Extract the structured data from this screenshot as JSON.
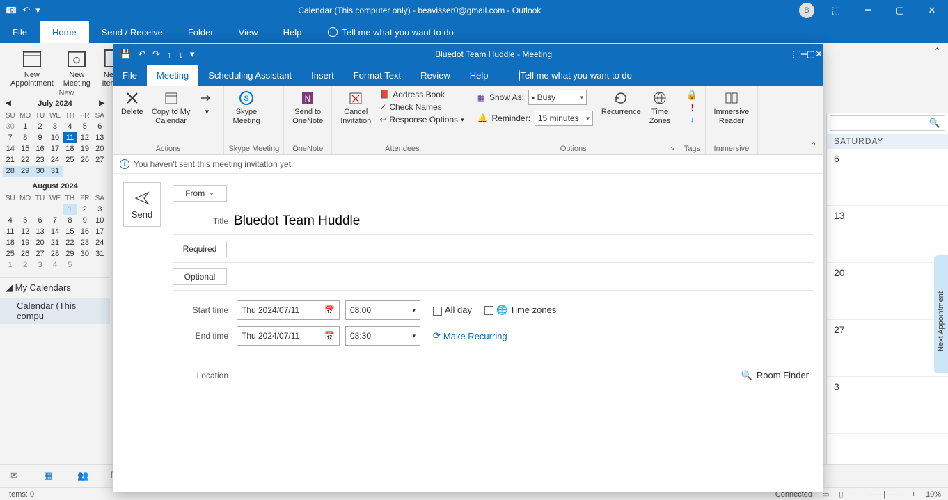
{
  "main": {
    "title": "Calendar (This computer only) - beavisser0@gmail.com  -  Outlook",
    "avatar": "B",
    "tabs": [
      "File",
      "Home",
      "Send / Receive",
      "Folder",
      "View",
      "Help"
    ],
    "active_tab": "Home",
    "tell_me": "Tell me what you want to do",
    "ribbon_buttons": {
      "new_appt": "New\nAppointment",
      "new_meeting": "New\nMeeting",
      "new_items": "New\nItems"
    },
    "ribbon_group": "New"
  },
  "calendars": {
    "month1": {
      "title": "July 2024",
      "headers": [
        "SU",
        "MO",
        "TU",
        "WE",
        "TH",
        "FR",
        "SA"
      ],
      "weeks": [
        [
          {
            "n": 30,
            "dim": 1
          },
          {
            "n": 1
          },
          {
            "n": 2
          },
          {
            "n": 3
          },
          {
            "n": 4
          },
          {
            "n": 5
          },
          {
            "n": 6
          }
        ],
        [
          {
            "n": 7
          },
          {
            "n": 8
          },
          {
            "n": 9
          },
          {
            "n": 10
          },
          {
            "n": 11,
            "today": 1
          },
          {
            "n": 12
          },
          {
            "n": 13
          }
        ],
        [
          {
            "n": 14
          },
          {
            "n": 15
          },
          {
            "n": 16
          },
          {
            "n": 17
          },
          {
            "n": 18
          },
          {
            "n": 19
          },
          {
            "n": 20
          }
        ],
        [
          {
            "n": 21
          },
          {
            "n": 22
          },
          {
            "n": 23
          },
          {
            "n": 24
          },
          {
            "n": 25
          },
          {
            "n": 26
          },
          {
            "n": 27
          }
        ],
        [
          {
            "n": 28,
            "sel": 1
          },
          {
            "n": 29,
            "sel": 1
          },
          {
            "n": 30,
            "sel": 1
          },
          {
            "n": 31,
            "sel": 1
          },
          {
            "n": ""
          },
          {
            "n": ""
          },
          {
            "n": ""
          }
        ]
      ]
    },
    "month2": {
      "title": "August 2024",
      "headers": [
        "SU",
        "MO",
        "TU",
        "WE",
        "TH",
        "FR",
        "SA"
      ],
      "weeks": [
        [
          {
            "n": ""
          },
          {
            "n": ""
          },
          {
            "n": ""
          },
          {
            "n": ""
          },
          {
            "n": 1,
            "sel": 1
          },
          {
            "n": 2
          },
          {
            "n": 3
          }
        ],
        [
          {
            "n": 4
          },
          {
            "n": 5
          },
          {
            "n": 6
          },
          {
            "n": 7
          },
          {
            "n": 8
          },
          {
            "n": 9
          },
          {
            "n": 10
          }
        ],
        [
          {
            "n": 11
          },
          {
            "n": 12
          },
          {
            "n": 13
          },
          {
            "n": 14
          },
          {
            "n": 15
          },
          {
            "n": 16
          },
          {
            "n": 17
          }
        ],
        [
          {
            "n": 18
          },
          {
            "n": 19
          },
          {
            "n": 20
          },
          {
            "n": 21
          },
          {
            "n": 22
          },
          {
            "n": 23
          },
          {
            "n": 24
          }
        ],
        [
          {
            "n": 25
          },
          {
            "n": 26
          },
          {
            "n": 27
          },
          {
            "n": 28
          },
          {
            "n": 29
          },
          {
            "n": 30
          },
          {
            "n": 31
          }
        ],
        [
          {
            "n": 1,
            "dim": 1
          },
          {
            "n": 2,
            "dim": 1
          },
          {
            "n": 3,
            "dim": 1
          },
          {
            "n": 4,
            "dim": 1
          },
          {
            "n": 5,
            "dim": 1
          },
          {
            "n": "",
            "dim": 1
          },
          {
            "n": "",
            "dim": 1
          }
        ]
      ]
    },
    "my_calendars": "My Calendars",
    "cal_entry": "Calendar (This compu"
  },
  "rightcol": {
    "header": "SATURDAY",
    "slots": [
      "6",
      "13",
      "20",
      "27",
      "3"
    ],
    "next": "Next Appointment"
  },
  "status": {
    "items": "Items: 0",
    "connected": "Connected",
    "zoom": "10%"
  },
  "meeting": {
    "title": "Bluedot Team Huddle  -  Meeting",
    "tabs": [
      "File",
      "Meeting",
      "Scheduling Assistant",
      "Insert",
      "Format Text",
      "Review",
      "Help"
    ],
    "active_tab": "Meeting",
    "tell_me": "Tell me what you want to do",
    "ribbon": {
      "delete": "Delete",
      "copy": "Copy to My\nCalendar",
      "actions": "Actions",
      "skype": "Skype\nMeeting",
      "skype_grp": "Skype Meeting",
      "onenote": "Send to\nOneNote",
      "onenote_grp": "OneNote",
      "cancel": "Cancel\nInvitation",
      "addr": "Address Book",
      "checknames": "Check Names",
      "respopts": "Response Options",
      "attendees": "Attendees",
      "showas": "Show As:",
      "showas_val": "Busy",
      "reminder": "Reminder:",
      "reminder_val": "15 minutes",
      "recur": "Recurrence",
      "tz": "Time\nZones",
      "options": "Options",
      "tags": "Tags",
      "immersive": "Immersive\nReader",
      "immersive_grp": "Immersive"
    },
    "info": "You haven't sent this meeting invitation yet.",
    "form": {
      "send": "Send",
      "from": "From",
      "title_label": "Title",
      "title_value": "Bluedot Team Huddle",
      "required": "Required",
      "optional": "Optional",
      "start": "Start time",
      "end": "End time",
      "start_date": "Thu 2024/07/11",
      "start_time": "08:00",
      "end_date": "Thu 2024/07/11",
      "end_time": "08:30",
      "allday": "All day",
      "timezones": "Time zones",
      "recurring": "Make Recurring",
      "location": "Location",
      "room_finder": "Room Finder"
    }
  }
}
